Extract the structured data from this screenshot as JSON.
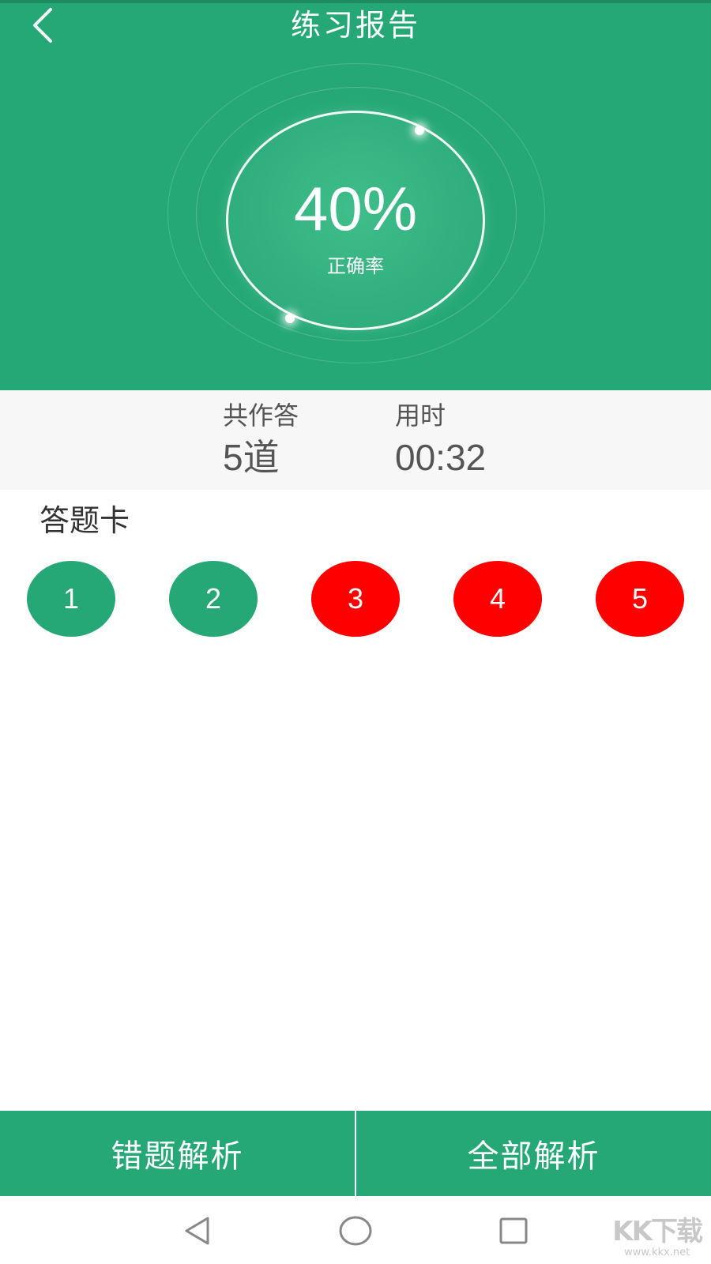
{
  "header": {
    "title": "练习报告",
    "accuracy_percent": "40%",
    "accuracy_label": "正确率"
  },
  "stats": {
    "answered_label": "共作答",
    "answered_value": "5道",
    "time_label": "用时",
    "time_value": "00:32"
  },
  "answer_card": {
    "title": "答题卡",
    "items": [
      {
        "number": "1",
        "status": "correct"
      },
      {
        "number": "2",
        "status": "correct"
      },
      {
        "number": "3",
        "status": "wrong"
      },
      {
        "number": "4",
        "status": "wrong"
      },
      {
        "number": "5",
        "status": "wrong"
      }
    ]
  },
  "bottom_bar": {
    "wrong_analysis_label": "错题解析",
    "all_analysis_label": "全部解析"
  },
  "watermark": {
    "main": "KK下载",
    "sub": "www.kkx.net"
  },
  "colors": {
    "primary_green": "#25a876",
    "wrong_red": "#fe0000",
    "stats_bg": "#f7f7f7"
  },
  "icons": {
    "back": "chevron-left-icon",
    "nav_back": "triangle-back-icon",
    "nav_home": "circle-home-icon",
    "nav_recent": "square-recent-icon"
  }
}
